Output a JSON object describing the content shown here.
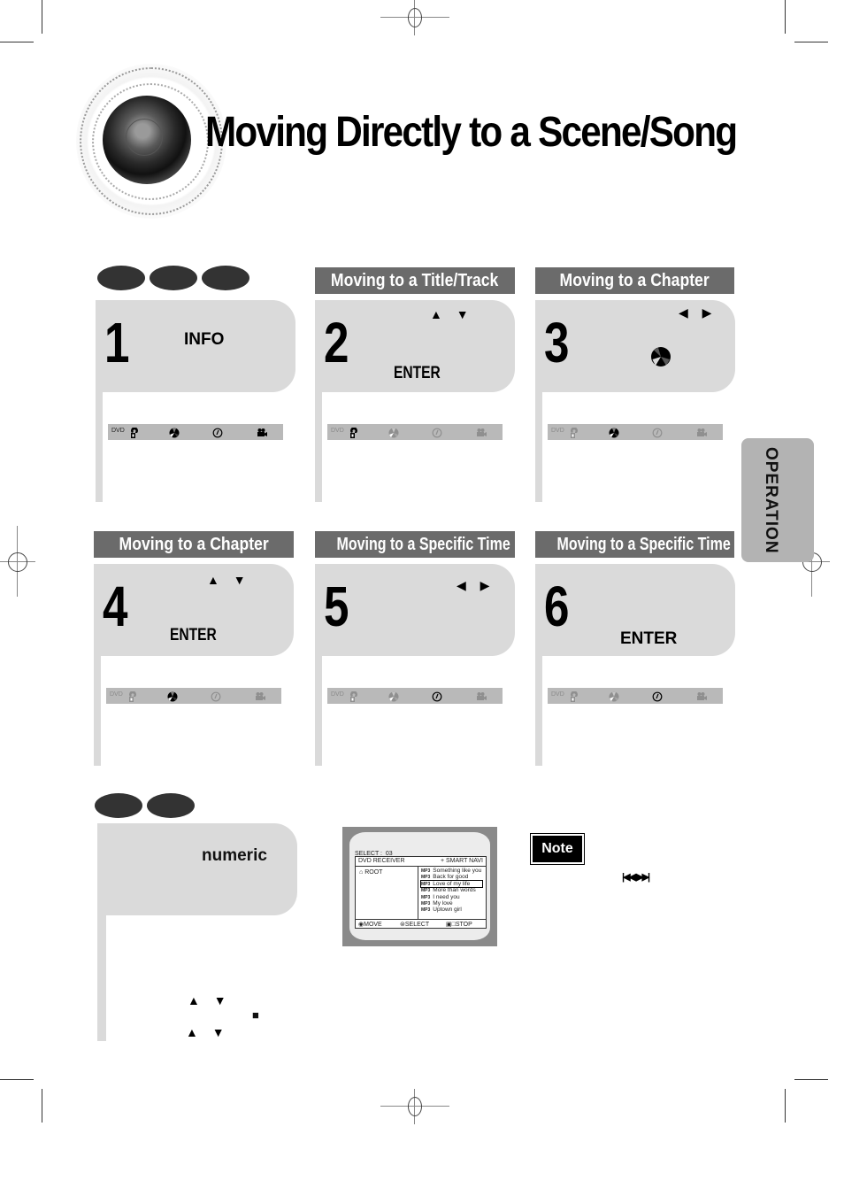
{
  "page": {
    "title": "Moving Directly to a Scene/Song",
    "side_tab": "OPERATION"
  },
  "top_pills": [
    "disc-format-1",
    "disc-format-2",
    "disc-format-3"
  ],
  "bottom_pills": [
    "disc-format-1",
    "disc-format-2"
  ],
  "steps": [
    {
      "number": "1",
      "section": "",
      "key": "INFO",
      "arrows": "",
      "osd": {
        "label": "DVD",
        "active": [
          "dvd",
          "title",
          "chapter",
          "time",
          "camera"
        ]
      }
    },
    {
      "number": "2",
      "section": "Moving to a Title/Track",
      "key": "ENTER",
      "arrows": "▲ ▼",
      "osd": {
        "label": "DVD",
        "active": [
          "title"
        ]
      }
    },
    {
      "number": "3",
      "section": "Moving to a Chapter",
      "key": "",
      "arrows": "◀ ▶",
      "osd": {
        "label": "DVD",
        "active": [
          "chapter"
        ]
      }
    },
    {
      "number": "4",
      "section": "Moving to a Chapter",
      "key": "ENTER",
      "arrows": "▲ ▼",
      "osd": {
        "label": "DVD",
        "active": [
          "chapter"
        ]
      }
    },
    {
      "number": "5",
      "section": "Moving to a Specific Time",
      "key": "",
      "arrows": "◀ ▶",
      "osd": {
        "label": "DVD",
        "active": [
          "time"
        ]
      }
    },
    {
      "number": "6",
      "section": "Moving to a Specific Time",
      "key": "ENTER",
      "arrows": "",
      "osd": {
        "label": "DVD",
        "active": [
          "time"
        ]
      }
    }
  ],
  "icons": {
    "title": "title-icon",
    "chapter": "chapter-disc-icon",
    "time": "clock-icon",
    "camera": "camera-angle-icon"
  },
  "numeric_card": {
    "key": "numeric",
    "arrows_1": "▲ ▼",
    "arrows_2": "▲ ▼",
    "stop_symbol": "■"
  },
  "screen": {
    "select_label": "SELECT :",
    "select_value": "03",
    "header_left": "DVD RECEIVER",
    "header_right": "+ SMART NAVI",
    "folder": "ROOT",
    "track_tag": "MP3",
    "songs": [
      "Something like you",
      "Back for good",
      "Love of my life",
      "More than words",
      "I need you",
      "My love",
      "Uptown girl"
    ],
    "selected_index": 2,
    "footer_move": "MOVE",
    "footer_select": "SELECT",
    "footer_stop": "STOP"
  },
  "note": {
    "label": "Note",
    "skip_symbols": "⏮ ⏭"
  }
}
